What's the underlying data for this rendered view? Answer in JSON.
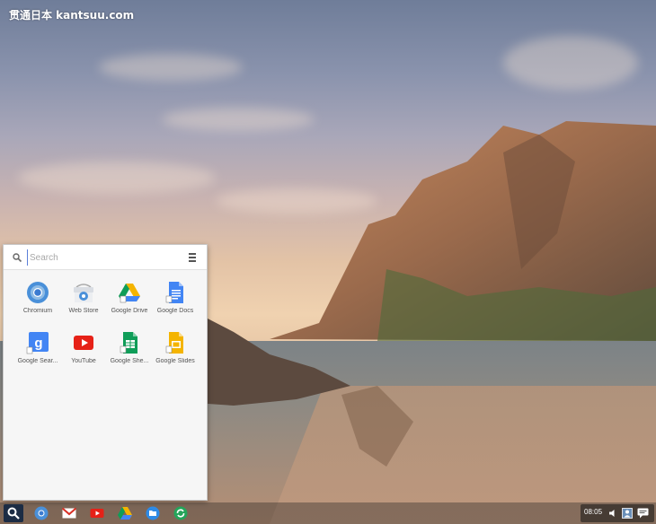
{
  "watermark": "贯通日本 kantsuu.com",
  "launcher": {
    "search": {
      "placeholder": "Search"
    },
    "apps": [
      {
        "name": "Chromium",
        "icon": "chromium-icon"
      },
      {
        "name": "Web Store",
        "icon": "web-store-icon"
      },
      {
        "name": "Google Drive",
        "icon": "google-drive-icon"
      },
      {
        "name": "Google Docs",
        "icon": "google-docs-icon"
      },
      {
        "name": "Google Sear...",
        "icon": "google-search-icon"
      },
      {
        "name": "YouTube",
        "icon": "youtube-icon"
      },
      {
        "name": "Google She...",
        "icon": "google-sheets-icon"
      },
      {
        "name": "Google Slides",
        "icon": "google-slides-icon"
      }
    ]
  },
  "shelf": {
    "items": [
      "launcher-search-icon",
      "chromium-icon",
      "gmail-icon",
      "youtube-icon",
      "google-drive-icon",
      "files-icon",
      "sync-icon"
    ],
    "clock": "08:05"
  },
  "colors": {
    "launcher_bg": "#f6f6f6",
    "accent_blue": "#4285f4",
    "youtube_red": "#e62117",
    "sheets_green": "#0f9d58",
    "slides_yellow": "#f4b400"
  }
}
